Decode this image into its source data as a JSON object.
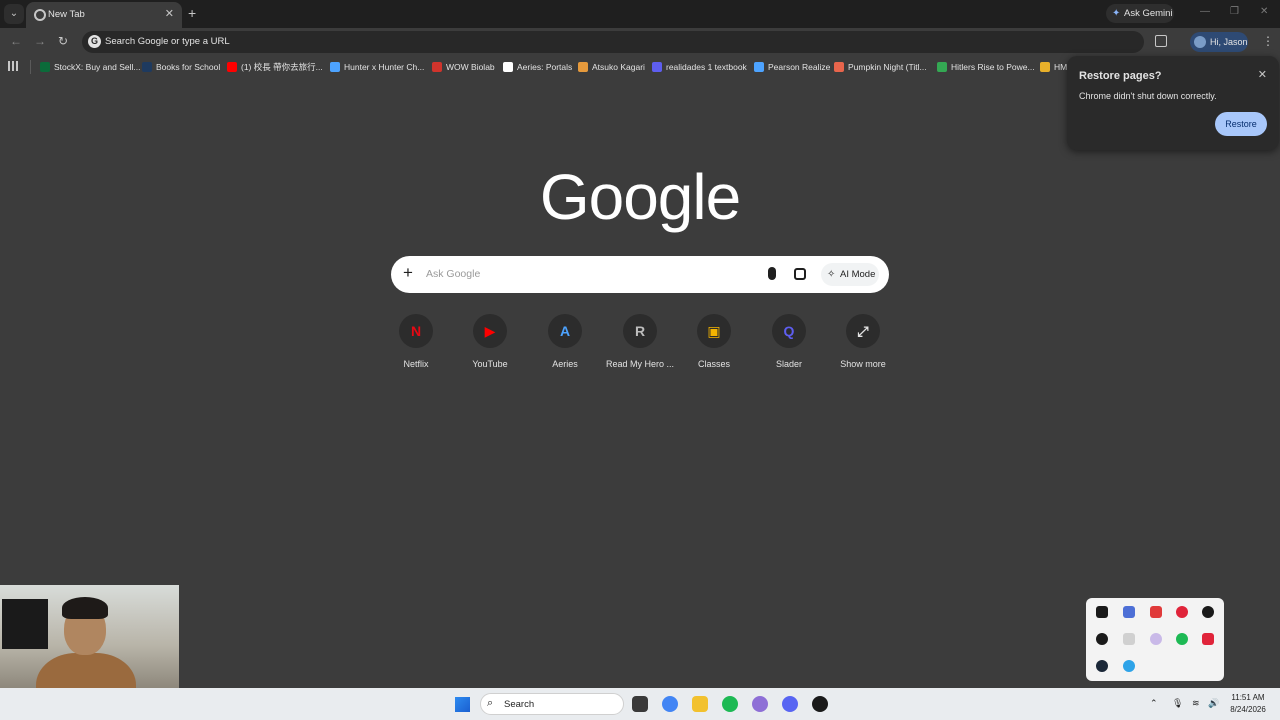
{
  "tab": {
    "title": "New Tab"
  },
  "titlebar": {
    "gemini_label": "Ask Gemini"
  },
  "toolbar": {
    "omnibox_text": "Search Google or type a URL",
    "profile_label": "Hi, Jason"
  },
  "bookmarks": [
    {
      "label": "StockX: Buy and Sell...",
      "color": "#0b6b3a"
    },
    {
      "label": "Books for School",
      "color": "#1e3a5f"
    },
    {
      "label": "(1) 校長 帶你去旅行...",
      "color": "#ff0000"
    },
    {
      "label": "Hunter x Hunter Ch...",
      "color": "#4da3ff"
    },
    {
      "label": "WOW Biolab",
      "color": "#d0342c"
    },
    {
      "label": "Aeries: Portals",
      "color": "#ffffff"
    },
    {
      "label": "Atsuko Kagari",
      "color": "#e69a3c"
    },
    {
      "label": "realidades 1 textbook",
      "color": "#5e5ef0"
    },
    {
      "label": "Pearson Realize",
      "color": "#4da3ff"
    },
    {
      "label": "Pumpkin Night (Titl...",
      "color": "#e8654c"
    },
    {
      "label": "Hitlers Rise to Powe...",
      "color": "#34a853"
    },
    {
      "label": "HM",
      "color": "#e8b02a"
    }
  ],
  "logo": "Google",
  "search": {
    "placeholder": "Ask Google",
    "ai_mode_label": "AI Mode"
  },
  "shortcuts": [
    {
      "label": "Netflix",
      "glyph": "N",
      "color": "#e50914"
    },
    {
      "label": "YouTube",
      "glyph": "▶",
      "color": "#ff0000"
    },
    {
      "label": "Aeries",
      "glyph": "A",
      "color": "#4da3ff"
    },
    {
      "label": "Read My Hero ...",
      "glyph": "R",
      "color": "#bdbdbd"
    },
    {
      "label": "Classes",
      "glyph": "▣",
      "color": "#f4b400"
    },
    {
      "label": "Slader",
      "glyph": "Q",
      "color": "#5e5ef0"
    },
    {
      "label": "Show more",
      "glyph": "⤢",
      "color": "#e3e3e3"
    }
  ],
  "restore_popup": {
    "title": "Restore pages?",
    "message": "Chrome didn't shut down correctly.",
    "button": "Restore"
  },
  "taskbar": {
    "search_label": "Search",
    "time": "11:51 AM",
    "date": "8/24/2026"
  }
}
